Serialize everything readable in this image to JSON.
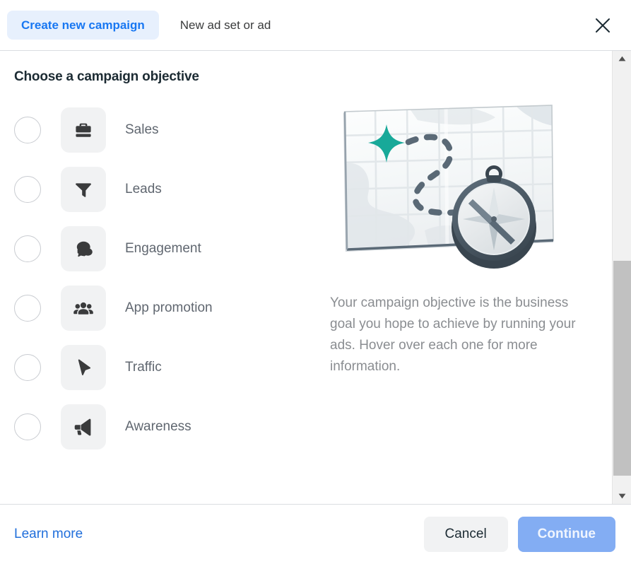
{
  "header": {
    "tabs": [
      {
        "label": "Create new campaign",
        "active": true
      },
      {
        "label": "New ad set or ad",
        "active": false
      }
    ],
    "close_icon": "close-icon"
  },
  "main": {
    "title": "Choose a campaign objective",
    "objectives": [
      {
        "label": "Sales",
        "icon": "briefcase-icon",
        "selected": false
      },
      {
        "label": "Leads",
        "icon": "funnel-icon",
        "selected": false
      },
      {
        "label": "Engagement",
        "icon": "speech-bubbles-icon",
        "selected": false
      },
      {
        "label": "App promotion",
        "icon": "people-group-icon",
        "selected": false
      },
      {
        "label": "Traffic",
        "icon": "cursor-arrow-icon",
        "selected": false
      },
      {
        "label": "Awareness",
        "icon": "megaphone-icon",
        "selected": false
      }
    ],
    "illustration": {
      "name": "map-and-compass-illustration",
      "star_color": "#18A999",
      "map_color": "#f7f9fa",
      "compass_ring_color": "#4a5a६8"
    },
    "description": "Your campaign objective is the business goal you hope to achieve by running your ads. Hover over each one for more information."
  },
  "scrollbar": {
    "up_icon": "triangle-up-icon",
    "down_icon": "triangle-down-icon",
    "thumb_top_pct": 46,
    "thumb_height_pct": 51
  },
  "footer": {
    "learn_more": "Learn more",
    "cancel": "Cancel",
    "continue": "Continue"
  },
  "colors": {
    "accent_blue": "#1877f2",
    "tab_active_bg": "#e7f0fd",
    "link_blue": "#216fdb",
    "continue_disabled": "#83adf3"
  }
}
